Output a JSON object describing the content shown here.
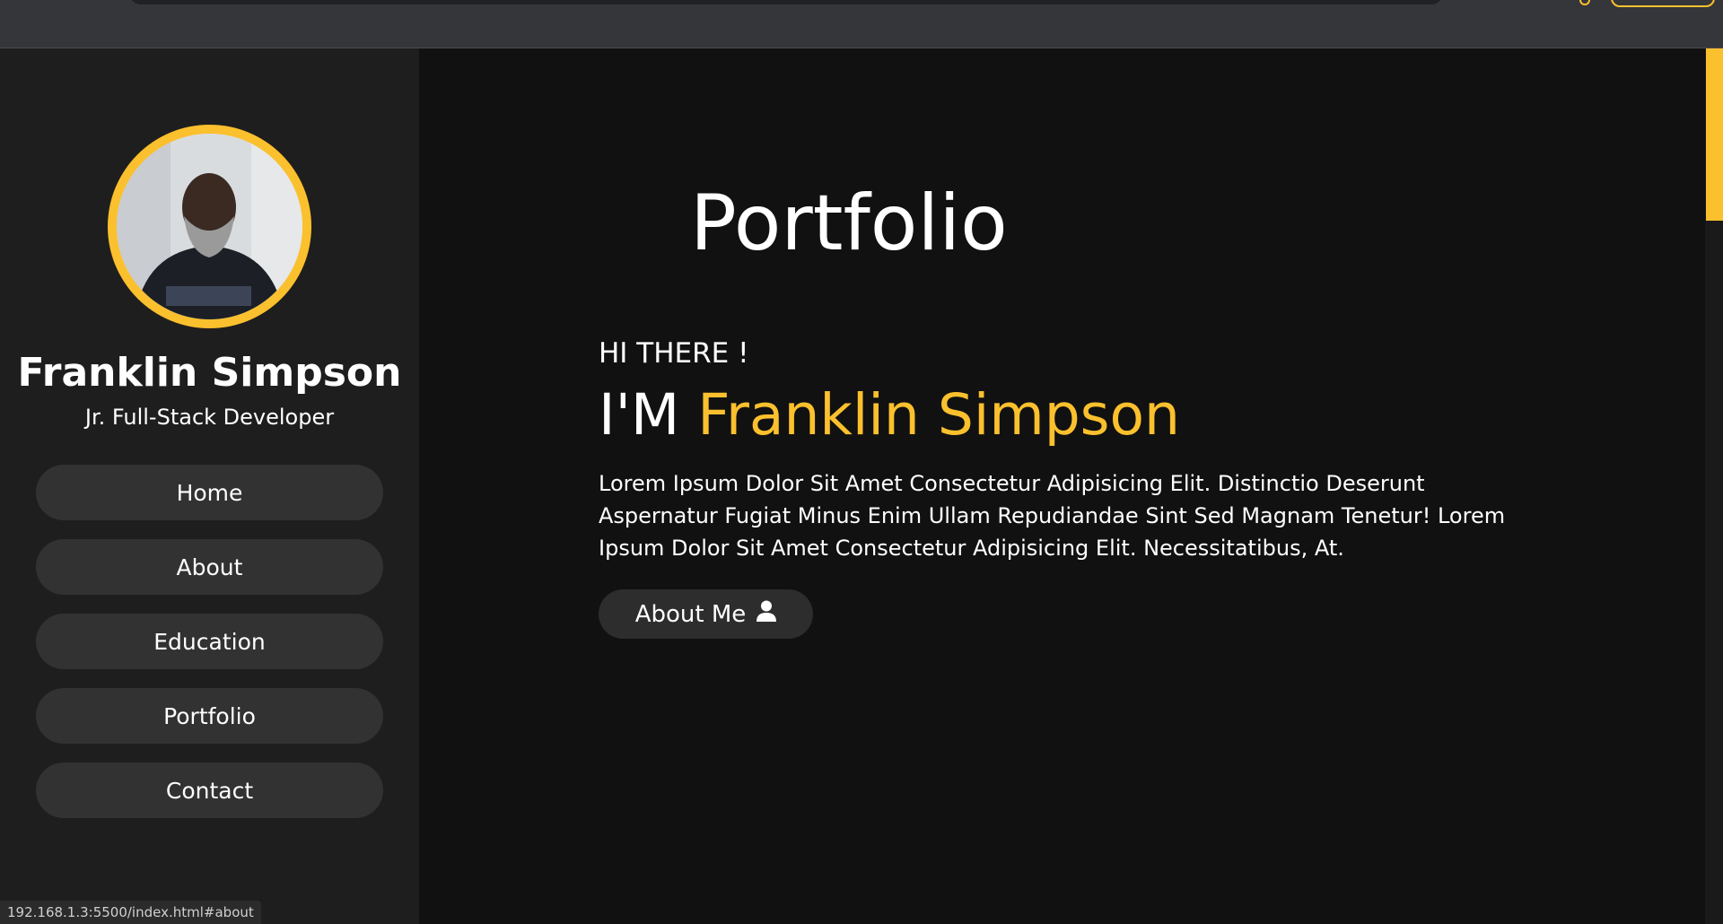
{
  "sidebar": {
    "name": "Franklin Simpson",
    "role": "Jr. Full-Stack Developer",
    "nav": [
      {
        "label": "Home"
      },
      {
        "label": "About"
      },
      {
        "label": "Education"
      },
      {
        "label": "Portfolio"
      },
      {
        "label": "Contact"
      }
    ]
  },
  "main": {
    "title": "Portfolio",
    "greeting": "HI THERE !",
    "intro_prefix": "I'M",
    "intro_name": "Franklin Simpson",
    "description": "Lorem Ipsum Dolor Sit Amet Consectetur Adipisicing Elit. Distinctio Deserunt Aspernatur Fugiat Minus Enim Ullam Repudiandae Sint Sed Magnam Tenetur! Lorem Ipsum Dolor Sit Amet Consectetur Adipisicing Elit. Necessitatibus, At.",
    "about_button": "About Me"
  },
  "status_bar": {
    "url": "192.168.1.3:5500/index.html#about"
  },
  "colors": {
    "accent": "#fbc02d",
    "sidebar_bg": "#1e1e1e",
    "main_bg": "#111111",
    "button_bg": "#323232"
  },
  "icons": {
    "about_button": "user-icon"
  }
}
